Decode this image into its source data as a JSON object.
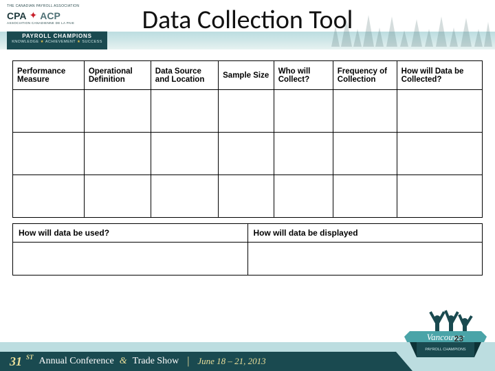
{
  "branding": {
    "org_line1": "THE CANADIAN PAYROLL ASSOCIATION",
    "org_abbr_left": "CPA",
    "org_abbr_right": "ACP",
    "org_line2": "ASSOCIATION CANADIENNE DE LA PAIE",
    "tagline_title": "PAYROLL CHAMPIONS",
    "tagline_sub1": "KNOWLEDGE",
    "tagline_sub2": "ACHIEVEMENT",
    "tagline_sub3": "SUCCESS"
  },
  "title": "Data Collection Tool",
  "table": {
    "headers": {
      "c1": "Performance Measure",
      "c2": "Operational Definition",
      "c3": "Data Source and Location",
      "c4": "Sample Size",
      "c5": "Who will Collect?",
      "c6": "Frequency of Collection",
      "c7": "How will Data be Collected?"
    }
  },
  "subtable": {
    "q1": "How will data be used?",
    "q2": "How will data be displayed"
  },
  "footer": {
    "ordinal_num": "31",
    "ordinal_suffix": "ST",
    "line_a": "Annual Conference",
    "line_amp": "&",
    "line_b": "Trade Show",
    "sep": "|",
    "dates": "June 18 – 21, 2013",
    "badge_city": "Vancouver",
    "badge_sub": "PAYROLL CHAMPIONS"
  },
  "page_number": "23"
}
